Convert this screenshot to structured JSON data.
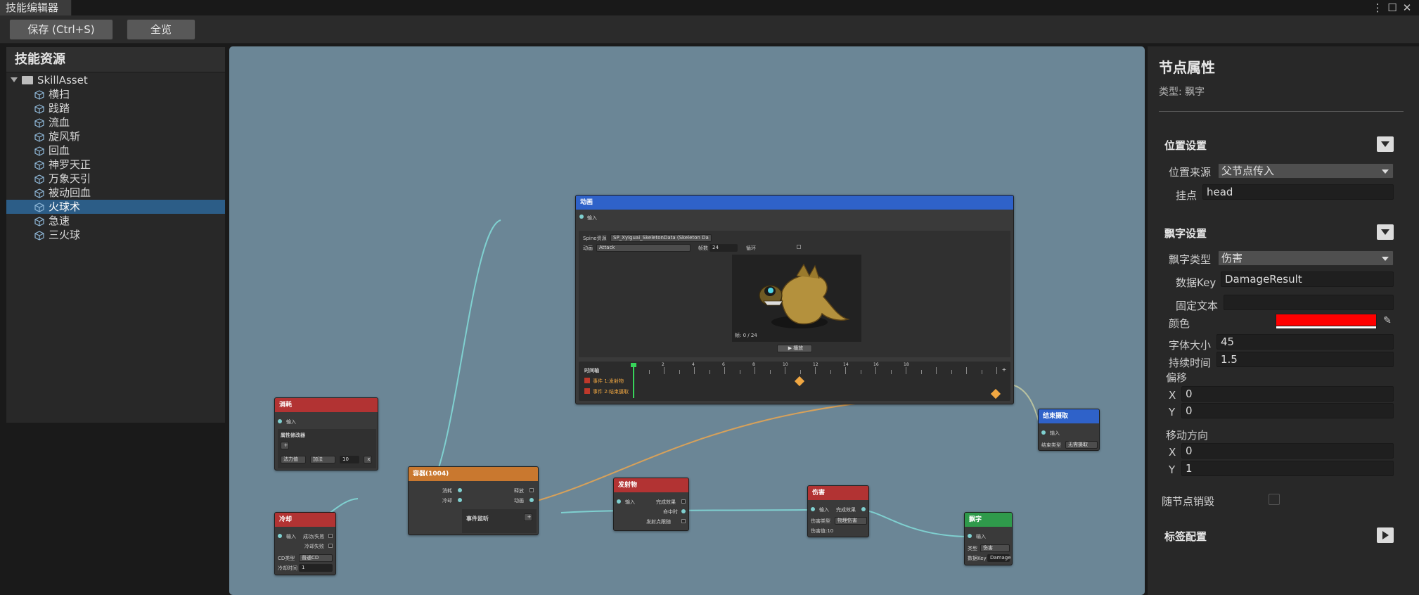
{
  "window": {
    "title": "技能编辑器"
  },
  "toolbar": {
    "save_label": "保存 (Ctrl+S)",
    "overview_label": "全览"
  },
  "left_panel": {
    "title": "技能资源",
    "root": "SkillAsset",
    "items": [
      "横扫",
      "践踏",
      "流血",
      "旋风斩",
      "回血",
      "神罗天正",
      "万象天引",
      "被动回血",
      "火球术",
      "急速",
      "三火球"
    ],
    "selected_index": 8
  },
  "graph": {
    "animation_node": {
      "title": "动画",
      "input": "输入",
      "spine_label": "Spine资源",
      "spine_value": "SP_Xyiguai_SkeletonData (Skeleton Da",
      "anim_label": "动画",
      "anim_value": "Attack",
      "fps_label": "帧数",
      "fps_value": "24",
      "loop_label": "循环",
      "frame_text": "帧: 0 / 24",
      "play_label": "▶ 播放",
      "timeline_label": "时间轴",
      "ticks": [
        "2",
        "4",
        "6",
        "8",
        "10",
        "12",
        "14",
        "16",
        "18"
      ],
      "add_label": "+",
      "events": [
        "事件 1:发射物",
        "事件 2:结束摄取"
      ]
    },
    "consume_node": {
      "title": "消耗",
      "input": "输入",
      "section": "属性修改器",
      "add": "+",
      "attr": "法力值",
      "op": "加法",
      "value": "10",
      "remove": "x"
    },
    "cooldown_node": {
      "title": "冷却",
      "input": "输入",
      "out1": "成功/失败",
      "out2": "冷却失败",
      "cd_label": "CD类型",
      "cd_value": "普通CD",
      "time_label": "冷却时间",
      "time_value": "1"
    },
    "event_node": {
      "title": "容器(1004)",
      "in1": "消耗",
      "in2": "冷却",
      "out1": "释放",
      "out2": "动画",
      "section": "事件监听",
      "add": "+"
    },
    "projectile_node": {
      "title": "发射物",
      "input": "输入",
      "out1": "完成效果",
      "out2": "命中时",
      "out3": "发射点跟随"
    },
    "damage_node": {
      "title": "伤害",
      "input": "输入",
      "out1": "完成效果",
      "type_label": "伤害类型",
      "type_value": "物理伤害",
      "value_label": "伤害值:10"
    },
    "float_node": {
      "title": "飘字",
      "input": "输入",
      "type_label": "类型",
      "type_value": "伤害",
      "key_label": "数据Key",
      "key_value": "Damage"
    },
    "end_node": {
      "title": "结束摄取",
      "input": "输入",
      "mode_label": "结束类型",
      "mode_value": "无需摄取"
    }
  },
  "right_panel": {
    "title": "节点属性",
    "type_line": "类型: 飘字",
    "position": {
      "header": "位置设置",
      "source_label": "位置来源",
      "source_value": "父节点传入",
      "attach_label": "挂点",
      "attach_value": "head"
    },
    "float_text": {
      "header": "飘字设置",
      "type_label": "飘字类型",
      "type_value": "伤害",
      "key_label": "数据Key",
      "key_value": "DamageResult",
      "fixed_label": "固定文本",
      "fixed_value": "",
      "color_label": "颜色",
      "color_value": "#ff0000",
      "size_label": "字体大小",
      "size_value": "45",
      "duration_label": "持续时间",
      "duration_value": "1.5",
      "offset_label": "偏移",
      "offset_x_label": "X",
      "offset_x": "0",
      "offset_y_label": "Y",
      "offset_y": "0",
      "move_label": "移动方向",
      "move_x_label": "X",
      "move_x": "0",
      "move_y_label": "Y",
      "move_y": "1",
      "destroy_label": "随节点销毁"
    },
    "tag_header": "标签配置"
  },
  "colors": {
    "accent_blue": "#2f62c9",
    "red_header": "#b23333",
    "orange_header": "#c9782f",
    "green_header": "#2f9a4b",
    "selection": "#2c5d87"
  }
}
